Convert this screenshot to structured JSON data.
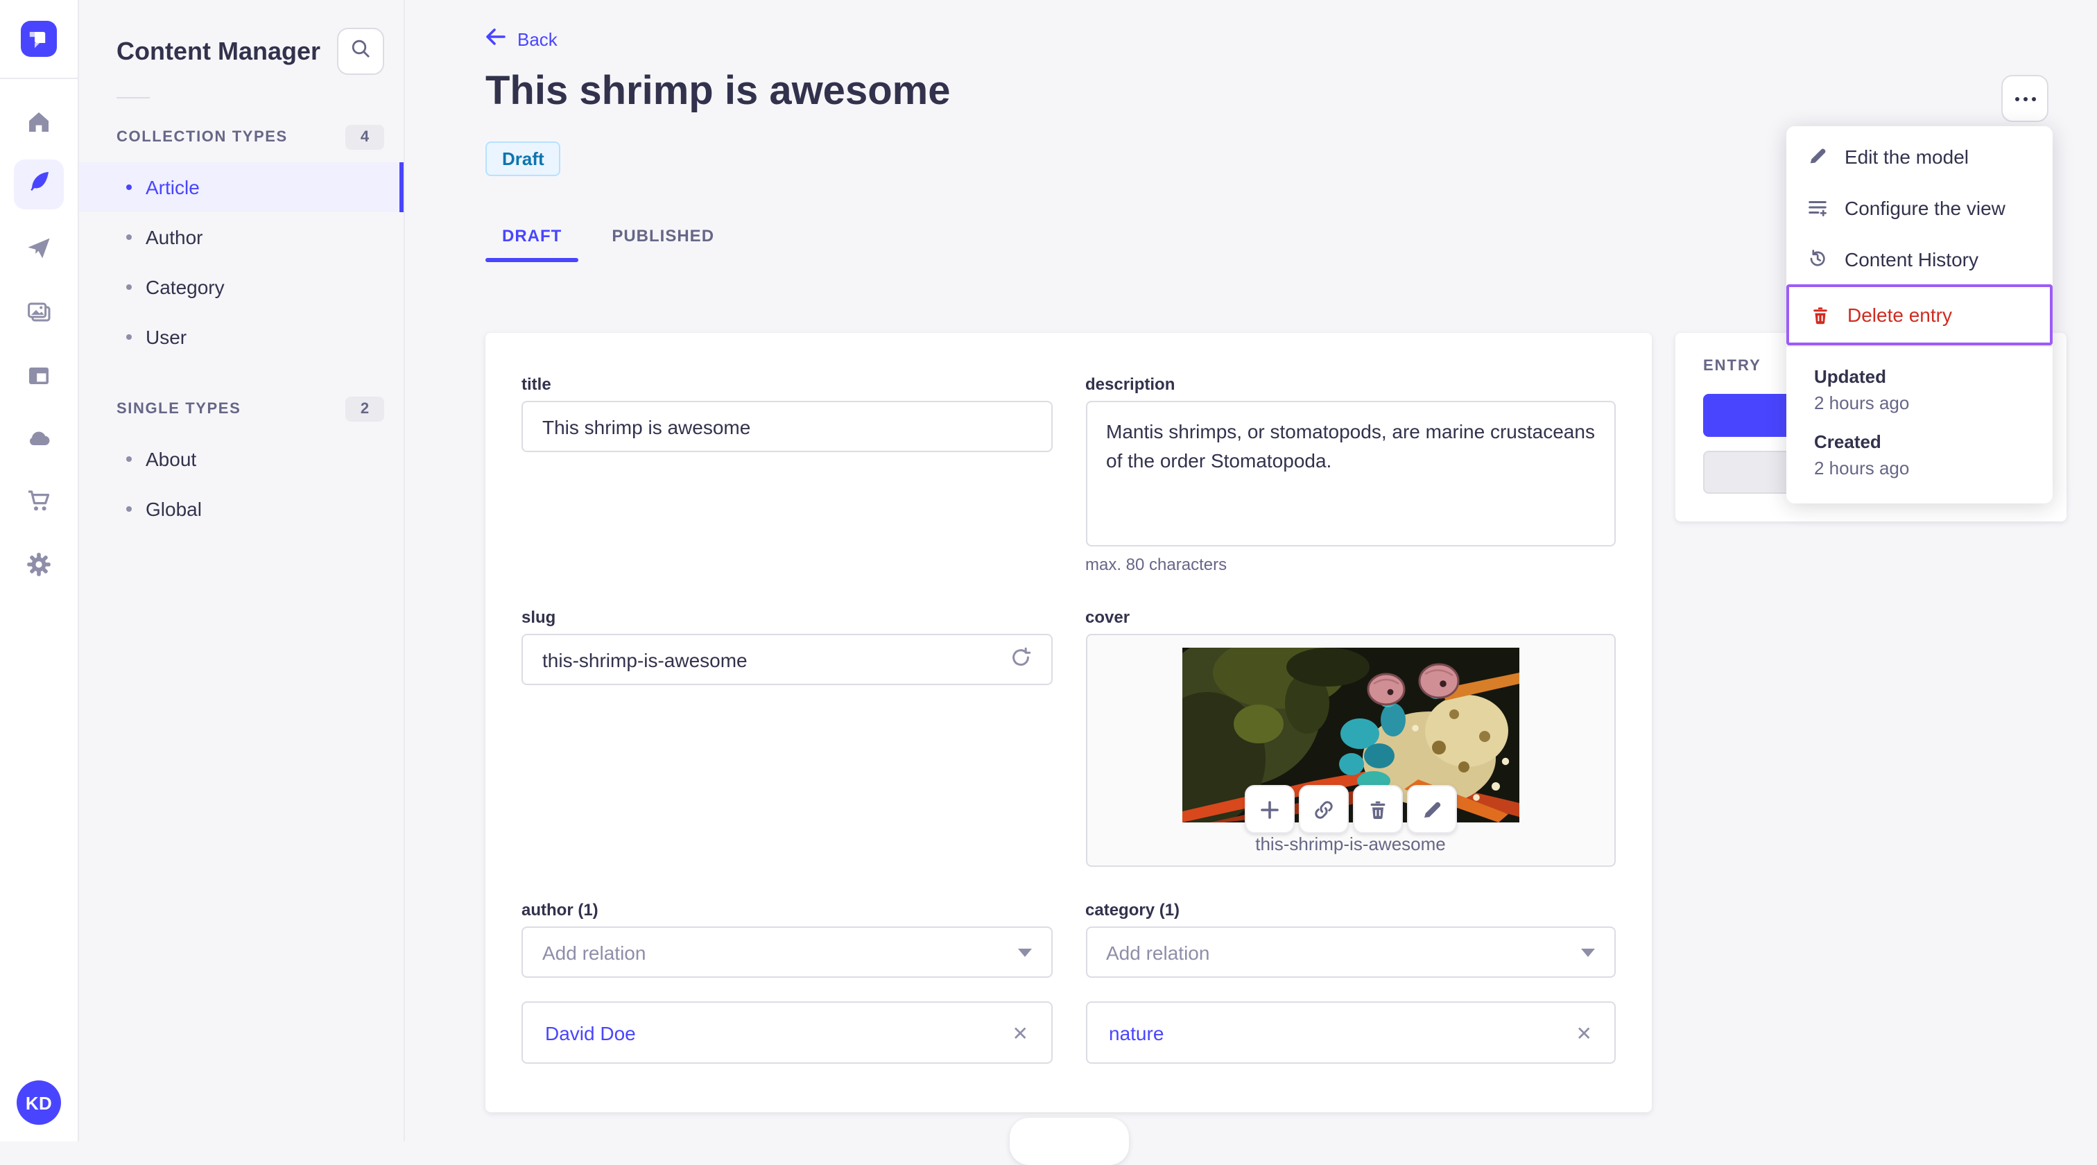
{
  "colors": {
    "accent": "#4945ff",
    "accent_bg": "#f0f0ff",
    "danger": "#d02b20",
    "highlight_border": "#9b5cf7",
    "draft_bg": "#eaf5ff",
    "draft_border": "#b8e1ff",
    "draft_text": "#0c75af",
    "text": "#32324d",
    "muted": "#666687",
    "border": "#dcdce4",
    "page_bg": "#f6f6f9"
  },
  "rail": {
    "logo_icon": "strapi-logo-icon",
    "icons": [
      "home-icon",
      "feather-icon",
      "paper-plane-icon",
      "media-library-icon",
      "layout-icon",
      "cloud-icon",
      "cart-icon",
      "gear-icon"
    ],
    "active_icon": "feather-icon"
  },
  "user": {
    "initials": "KD"
  },
  "sidebar": {
    "title": "Content Manager",
    "search_icon": "search-icon",
    "sections": [
      {
        "label": "COLLECTION TYPES",
        "count": "4",
        "items": [
          {
            "label": "Article",
            "active": true
          },
          {
            "label": "Author"
          },
          {
            "label": "Category"
          },
          {
            "label": "User"
          }
        ]
      },
      {
        "label": "SINGLE TYPES",
        "count": "2",
        "items": [
          {
            "label": "About"
          },
          {
            "label": "Global"
          }
        ]
      }
    ]
  },
  "header": {
    "back_label": "Back",
    "back_icon": "arrow-left-icon",
    "title": "This shrimp is awesome",
    "status_badge": "Draft",
    "more_icon": "ellipsis-icon",
    "tabs": [
      {
        "label": "DRAFT",
        "active": true
      },
      {
        "label": "PUBLISHED",
        "active": false
      }
    ]
  },
  "form": {
    "title": {
      "label": "title",
      "value": "This shrimp is awesome"
    },
    "description": {
      "label": "description",
      "value": "Mantis shrimps, or stomatopods, are marine crustaceans of the order Stomatopoda.",
      "hint": "max. 80 characters"
    },
    "slug": {
      "label": "slug",
      "value": "this-shrimp-is-awesome",
      "icon": "regenerate-icon"
    },
    "cover": {
      "label": "cover",
      "caption": "this-shrimp-is-awesome",
      "action_icons": [
        "plus-icon",
        "link-icon",
        "trash-icon",
        "pencil-icon"
      ]
    },
    "author": {
      "label": "author (1)",
      "placeholder": "Add relation",
      "relations": [
        "David Doe"
      ],
      "close_icon": "close-icon"
    },
    "category": {
      "label": "category (1)",
      "placeholder": "Add relation",
      "relations": [
        "nature"
      ],
      "close_icon": "close-icon"
    }
  },
  "entry_panel": {
    "title": "ENTRY"
  },
  "menu": {
    "items": [
      {
        "label": "Edit the model",
        "icon": "pencil-icon"
      },
      {
        "label": "Configure the view",
        "icon": "configure-list-icon"
      },
      {
        "label": "Content History",
        "icon": "history-icon"
      },
      {
        "label": "Delete entry",
        "icon": "trash-icon",
        "danger": true,
        "highlighted": true
      }
    ],
    "meta": [
      {
        "label": "Updated",
        "value": "2 hours ago"
      },
      {
        "label": "Created",
        "value": "2 hours ago"
      }
    ]
  }
}
